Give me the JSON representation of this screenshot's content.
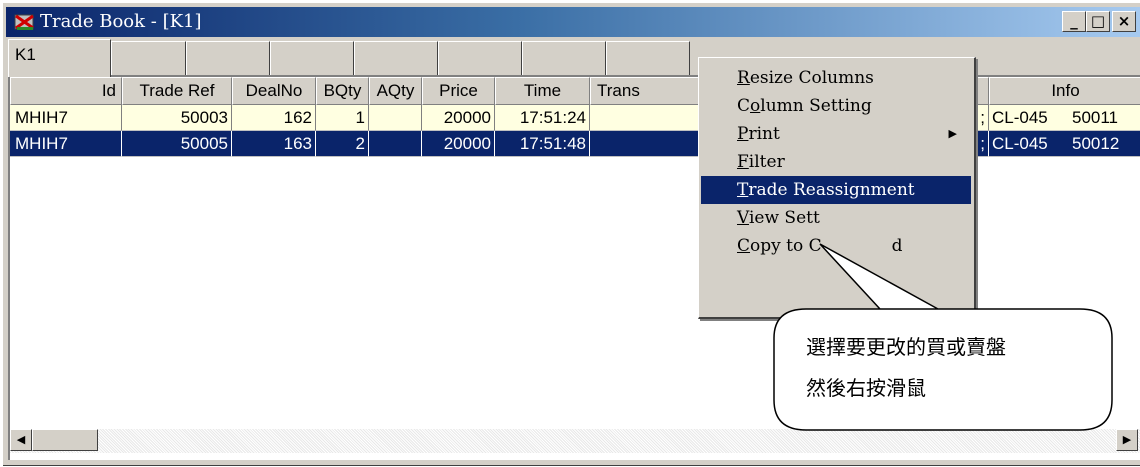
{
  "window": {
    "title": "Trade Book - [K1]",
    "buttons": {
      "minimize": "_",
      "maximize": "□",
      "close": "×"
    }
  },
  "tabs": [
    {
      "label": "K1",
      "active": true
    },
    {
      "label": ""
    },
    {
      "label": ""
    },
    {
      "label": ""
    },
    {
      "label": ""
    },
    {
      "label": ""
    },
    {
      "label": ""
    },
    {
      "label": ""
    }
  ],
  "table": {
    "columns": [
      "Id",
      "Trade Ref",
      "DealNo",
      "BQty",
      "AQty",
      "Price",
      "Time",
      "Trans",
      "",
      "Info",
      ""
    ],
    "rows": [
      {
        "id": "MHIH7",
        "trade_ref": "50003",
        "deal_no": "162",
        "bqty": "1",
        "aqty": "",
        "price": "20000",
        "time": "17:51:24",
        "trans": "",
        "hidden": ";",
        "info": "CL-045",
        "info2": "50011"
      },
      {
        "id": "MHIH7",
        "trade_ref": "50005",
        "deal_no": "163",
        "bqty": "2",
        "aqty": "",
        "price": "20000",
        "time": "17:51:48",
        "trans": "",
        "hidden": ";",
        "info": "CL-045",
        "info2": "50012"
      }
    ]
  },
  "context_menu": {
    "items": [
      {
        "label": "Resize Columns",
        "mnemonic": "R",
        "rest": "esize Columns",
        "pre": ""
      },
      {
        "label": "Column Setting",
        "mnemonic": "o",
        "rest": "lumn Setting",
        "pre": "C"
      },
      {
        "label": "Print",
        "mnemonic": "P",
        "rest": "rint",
        "pre": "",
        "submenu": "▶"
      },
      {
        "label": "Filter",
        "mnemonic": "F",
        "rest": "ilter",
        "pre": ""
      },
      {
        "label": "Trade Reassignment",
        "mnemonic": "T",
        "rest": "rade Reassignment",
        "pre": "",
        "selected": true
      },
      {
        "label": "View Settings",
        "mnemonic": "V",
        "rest": "iew Sett",
        "pre": ""
      },
      {
        "label": "Copy to Clipboard",
        "mnemonic": "C",
        "rest": "opy to C",
        "pre": "",
        "tail": "d"
      }
    ]
  },
  "callout": {
    "line1": "選擇要更改的買或賣盤",
    "line2": "然後右按滑鼠"
  },
  "scrollbar": {
    "left_arrow": "◀",
    "right_arrow": "▶"
  },
  "colors": {
    "selection": "#0a246a",
    "row_highlight": "#ffffe1",
    "face": "#d4d0c8"
  }
}
